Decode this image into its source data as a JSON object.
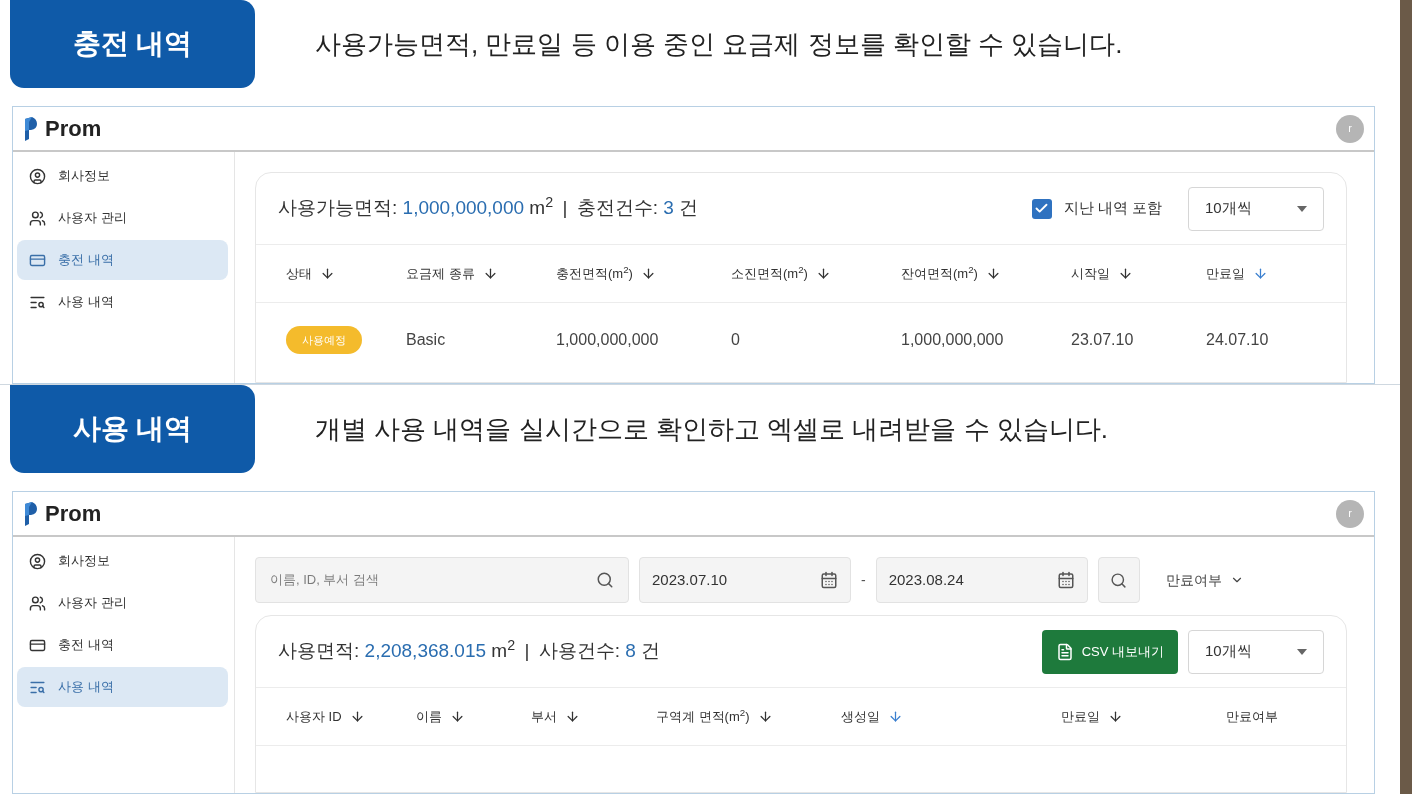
{
  "sections": [
    {
      "kind": "charge",
      "heading": "충전 내역",
      "caption": "사용가능면적, 만료일 등 이용 중인 요금제 정보를 확인할 수 있습니다.",
      "app": {
        "logo": "Prom",
        "avatar": "r",
        "sidebar": [
          {
            "label": "회사정보",
            "selected": false
          },
          {
            "label": "사용자 관리",
            "selected": false
          },
          {
            "label": "충전 내역",
            "selected": true
          },
          {
            "label": "사용 내역",
            "selected": false
          }
        ]
      },
      "summary": {
        "area_label": "사용가능면적:",
        "area_value": "1,000,000,000",
        "area_unit": "m$^{2}$",
        "separator": "|",
        "count_label": "충전건수:",
        "count_value": "3",
        "count_unit": "건"
      },
      "include_past": {
        "label": "지난 내역 포함",
        "checked": true
      },
      "page_size": "10개씩",
      "columns": [
        {
          "label": "상태",
          "sortable": true,
          "sort_active": false
        },
        {
          "label": "요금제 종류",
          "sortable": true,
          "sort_active": false
        },
        {
          "label": "충전면적(m$^{2}$)",
          "sortable": true,
          "sort_active": false
        },
        {
          "label": "소진면적(m$^{2}$)",
          "sortable": true,
          "sort_active": false
        },
        {
          "label": "잔여면적(m$^{2}$)",
          "sortable": true,
          "sort_active": false
        },
        {
          "label": "시작일",
          "sortable": true,
          "sort_active": false
        },
        {
          "label": "만료일",
          "sortable": true,
          "sort_active": true
        }
      ],
      "rows": [
        {
          "color": "#f4bb2c",
          "cells": [
            "사용예정",
            "Basic",
            "1,000,000,000",
            "0",
            "1,000,000,000",
            "23.07.10",
            "24.07.10"
          ]
        }
      ]
    },
    {
      "kind": "usage",
      "heading": "사용 내역",
      "caption": "개별 사용 내역을 실시간으로 확인하고 엑셀로 내려받을 수 있습니다.",
      "app": {
        "logo": "Prom",
        "avatar": "r",
        "sidebar": [
          {
            "label": "회사정보",
            "selected": false
          },
          {
            "label": "사용자 관리",
            "selected": false
          },
          {
            "label": "충전 내역",
            "selected": false
          },
          {
            "label": "사용 내역",
            "selected": true
          }
        ]
      },
      "filters": {
        "search_placeholder": "이름, ID, 부서 검색",
        "date_from": "2023.07.10",
        "date_separator": "-",
        "date_to": "2023.08.24",
        "expiry_filter": "만료여부"
      },
      "summary": {
        "area_label": "사용면적:",
        "area_value": "2,208,368.015",
        "area_unit": "m$^{2}$",
        "separator": "|",
        "count_label": "사용건수:",
        "count_value": "8",
        "count_unit": "건"
      },
      "export_button": "CSV 내보내기",
      "page_size": "10개씩",
      "columns": [
        {
          "label": "사용자 ID",
          "sortable": true,
          "sort_active": false
        },
        {
          "label": "이름",
          "sortable": true,
          "sort_active": false
        },
        {
          "label": "부서",
          "sortable": true,
          "sort_active": false
        },
        {
          "label": "구역계 면적(m$^{2}$)",
          "sortable": true,
          "sort_active": false
        },
        {
          "label": "생성일",
          "sortable": true,
          "sort_active": true
        },
        {
          "label": "만료일",
          "sortable": true,
          "sort_active": false
        },
        {
          "label": "만료여부",
          "sortable": false
        }
      ]
    }
  ]
}
